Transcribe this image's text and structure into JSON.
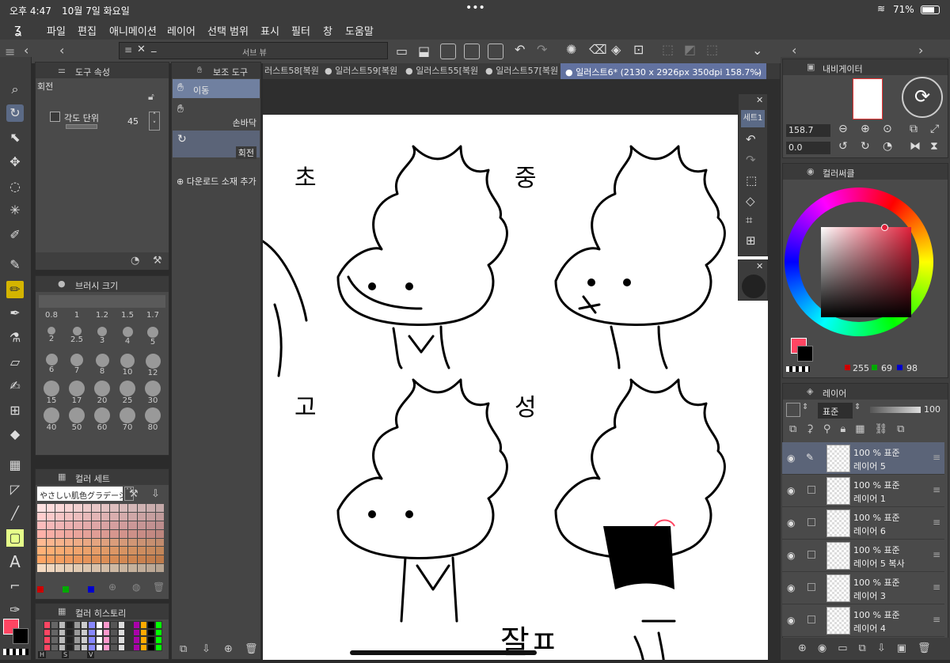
{
  "status": {
    "time": "오후 4:47",
    "date": "10월 7일 화요일",
    "battery": "71%"
  },
  "menu": [
    "파일",
    "편집",
    "애니메이션",
    "레이어",
    "선택 범위",
    "표시",
    "필터",
    "창",
    "도움말"
  ],
  "subview": {
    "title": "서브 뷰"
  },
  "tabs": [
    "러스트58[복원",
    "일러스트59[복원",
    "일러스트55[복원",
    "일러스트57[복원",
    "일러스트6* (2130 x 2926px 350dpi 158.7%)"
  ],
  "tool_property": {
    "title": "도구 속성",
    "tool_name": "회전",
    "angle_unit_label": "각도 단위",
    "angle_value": "45"
  },
  "sub_tool": {
    "title": "보조 도구",
    "items": [
      "이동",
      "손바닥",
      "회전"
    ],
    "download": "다운로드 소재 추가"
  },
  "brush_size": {
    "title": "브러시 크기",
    "top_row": [
      "0.8",
      "1",
      "1.2",
      "1.5",
      "1.7"
    ],
    "sizes": [
      "2",
      "2.5",
      "3",
      "4",
      "5",
      "6",
      "7",
      "8",
      "10",
      "12",
      "15",
      "17",
      "20",
      "25",
      "30",
      "40",
      "50",
      "60",
      "70",
      "80"
    ]
  },
  "color_set": {
    "title": "컬러 세트",
    "set_name": "やさしい肌色グラデーション"
  },
  "color_history": {
    "title": "컬러 히스토리",
    "labels": [
      "H",
      "S",
      "V"
    ]
  },
  "navigator": {
    "title": "내비게이터",
    "zoom": "158.7",
    "angle": "0.0"
  },
  "color_circle": {
    "title": "컬러써클",
    "r": "255",
    "g": "69",
    "b": "98",
    "accent": "#ff4562"
  },
  "quick_panel": {
    "label": "세트1"
  },
  "layers": {
    "title": "레이어",
    "blend": "표준",
    "opacity": "100",
    "items": [
      {
        "pct": "100 % 표준",
        "name": "레이어 5"
      },
      {
        "pct": "100 % 표준",
        "name": "레이어 1"
      },
      {
        "pct": "100 % 표준",
        "name": "레이어 6"
      },
      {
        "pct": "100 % 표준",
        "name": "레이어 5 복사"
      },
      {
        "pct": "100 % 표준",
        "name": "레이어 3"
      },
      {
        "pct": "100 % 표준",
        "name": "레이어 4"
      }
    ]
  },
  "canvas_labels": [
    "초",
    "중",
    "고",
    "성",
    "잘ㅍ"
  ]
}
